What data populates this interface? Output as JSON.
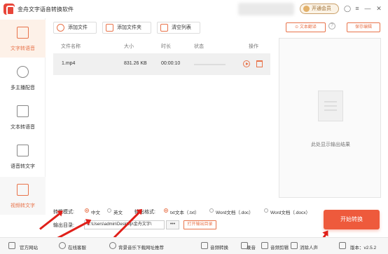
{
  "app": {
    "title": "金舟文字语音转换软件"
  },
  "titlebar": {
    "vip_label": "开通会员",
    "icons": [
      "user-icon",
      "menu-icon",
      "minimize-icon",
      "close-icon"
    ]
  },
  "sidebar": {
    "items": [
      {
        "label": "文字转语音",
        "state": "active"
      },
      {
        "label": "多主播配音",
        "state": "normal"
      },
      {
        "label": "文本转语音",
        "state": "normal"
      },
      {
        "label": "语音转文字",
        "state": "normal"
      },
      {
        "label": "视频转文字",
        "state": "selected"
      }
    ]
  },
  "toolbar": {
    "add_file": "添加文件",
    "add_folder": "添加文件夹",
    "clear_list": "清空列表",
    "text_translate": "文本翻译",
    "save_edit": "保存编辑",
    "help": "?"
  },
  "table": {
    "headers": {
      "name": "文件名称",
      "size": "大小",
      "duration": "时长",
      "status": "状态",
      "actions": "操作"
    },
    "rows": [
      {
        "name": "1.mp4",
        "size": "831.26 KB",
        "duration": "00:00:10",
        "progress": 0
      }
    ]
  },
  "preview": {
    "hint": "此处显示输出结果"
  },
  "settings": {
    "mode_label": "转换模式:",
    "mode_options": [
      "中文",
      "英文"
    ],
    "mode_selected": "中文",
    "format_label": "输出格式:",
    "format_options": [
      "txt文本（.txt）",
      "Word文档（.doc）",
      "Word文档（.docx）"
    ],
    "format_selected": "txt文本（.txt）",
    "dir_label": "输出目录:",
    "dir_value": "C:\\Users\\admin\\Desktop\\金舟文字\\",
    "dots": "•••",
    "open_dir": "打开输出目录",
    "start": "开始转换"
  },
  "statusbar": {
    "items": [
      "官方网站",
      "在线客服",
      "背景音乐下载网址推荐",
      "音频转换",
      "录音",
      "音频剪辑",
      "消除人声"
    ],
    "version": "版本：v2.5.2"
  },
  "colors": {
    "accent": "#e8734a",
    "start_button": "#ee5a3c",
    "annotation_arrow": "#e0201a"
  }
}
